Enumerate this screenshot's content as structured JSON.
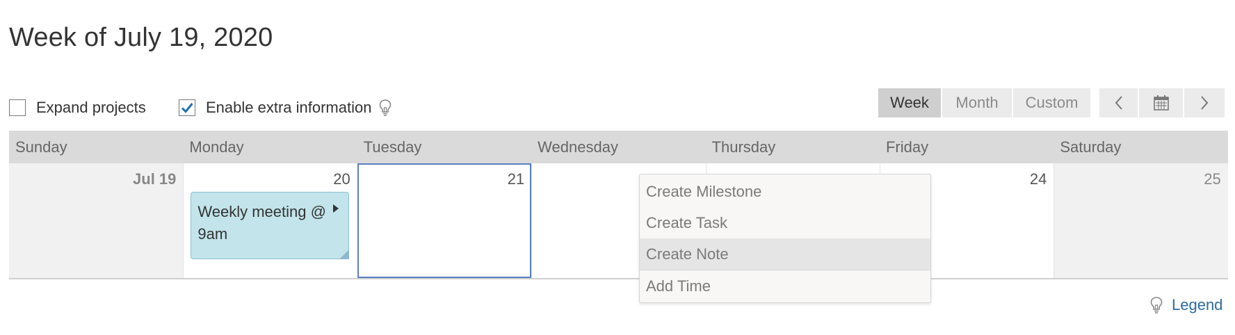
{
  "header": {
    "title": "Week of July 19, 2020"
  },
  "options": {
    "expand_projects": {
      "label": "Expand projects",
      "checked": false
    },
    "extra_info": {
      "label": "Enable extra information",
      "checked": true
    }
  },
  "view_switch": {
    "week": "Week",
    "month": "Month",
    "custom": "Custom",
    "active": "Week"
  },
  "nav": {
    "prev_icon": "chevron-left-icon",
    "calendar_icon": "calendar-icon",
    "next_icon": "chevron-right-icon"
  },
  "calendar": {
    "weekdays": [
      "Sunday",
      "Monday",
      "Tuesday",
      "Wednesday",
      "Thursday",
      "Friday",
      "Saturday"
    ],
    "dates": [
      "Jul 19",
      "20",
      "21",
      "",
      "",
      "24",
      "25"
    ],
    "selected_day": "21"
  },
  "event": {
    "title": "Weekly meeting @ 9am",
    "color": "#c2e4ea"
  },
  "context_menu": {
    "items": [
      "Create Milestone",
      "Create Task",
      "Create Note",
      "Add Time"
    ],
    "highlighted": "Create Note"
  },
  "legend": {
    "label": "Legend"
  },
  "colors": {
    "selection": "#5b7fc0",
    "link": "#2b6aa3",
    "checkbox": "#1f6fb2"
  }
}
